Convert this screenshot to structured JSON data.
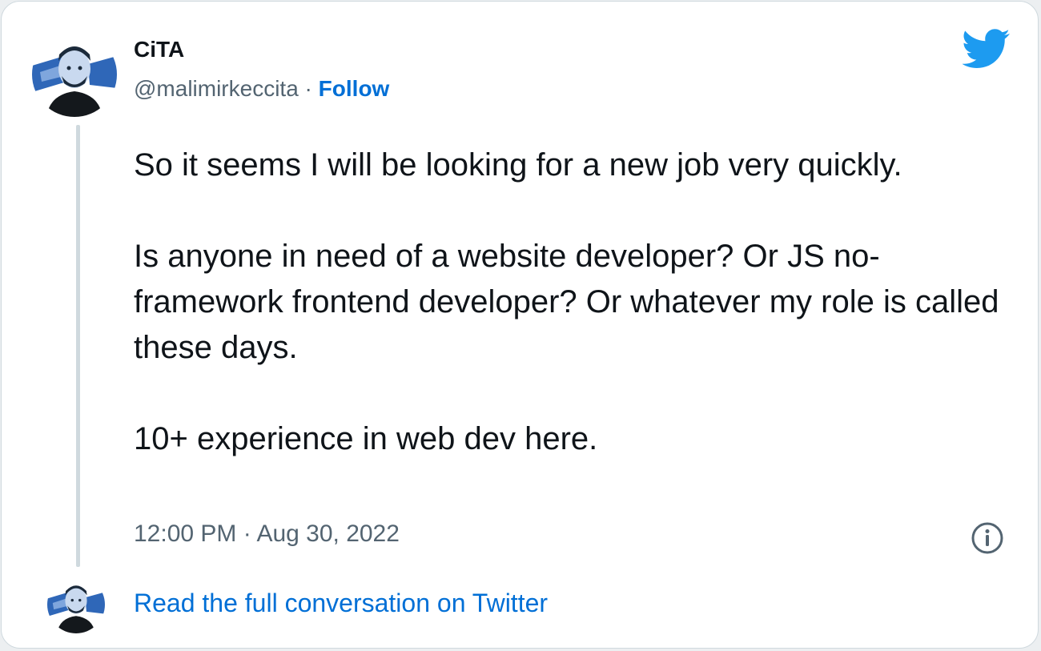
{
  "tweet": {
    "display_name": "CiTA",
    "handle": "@malimirkeccita",
    "separator": " · ",
    "follow_label": "Follow",
    "text": "So it seems I will be looking for a new job very quickly.\n\nIs anyone in need of a website developer? Or JS no-framework frontend developer? Or whatever my role is called these days.\n\n10+ experience in web dev here.",
    "time": "12:00 PM",
    "date": "Aug 30, 2022",
    "date_separator": " · "
  },
  "footer": {
    "read_label": "Read the full conversation on Twitter"
  },
  "icons": {
    "logo": "twitter-bird-icon",
    "info": "info-icon"
  },
  "colors": {
    "accent": "#1d9bf0",
    "link": "#006fd6",
    "text": "#0f1419",
    "muted": "#536471",
    "border": "#cfd9de"
  }
}
